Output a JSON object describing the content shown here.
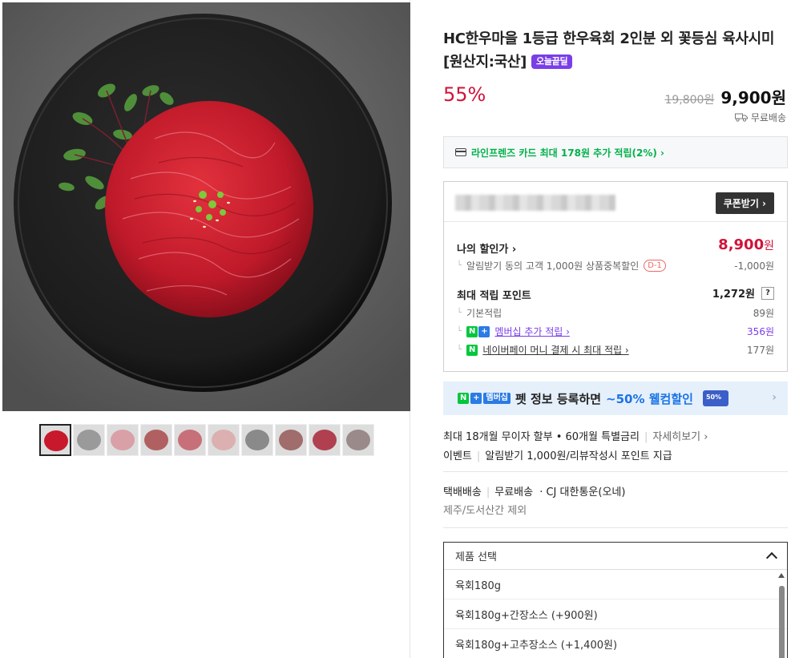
{
  "product": {
    "title": "HC한우마을 1등급 한우육회 2인분 외 꽃등심 육사시미 [원산지:국산]",
    "badge": "오늘끝딜",
    "discount_rate": "55%",
    "original_price": "19,800원",
    "sale_price": "9,900원",
    "delivery": "무료배송"
  },
  "thumbnails": {
    "count": 10,
    "colors": [
      "#c8182c",
      "#9a9a9a",
      "#d9a0a8",
      "#b06060",
      "#c8707a",
      "#dcb0b0",
      "#8a8a8a",
      "#a06c6c",
      "#b04050",
      "#9a8a8a"
    ]
  },
  "card_benefit": "라인프렌즈 카드 최대 178원 추가 적립(2%) ›",
  "benefit": {
    "coupon_button": "쿠폰받기 ›",
    "my_price_label": "나의 할인가 ›",
    "my_price": "8,900",
    "my_price_unit": "원",
    "notify_discount_label": "알림받기 동의 고객 1,000원 상품중복할인",
    "notify_discount_tag": "D-1",
    "notify_discount_value": "-1,000원",
    "max_point_label": "최대 적립 포인트",
    "max_point_value": "1,272원",
    "help_label": "?",
    "basic_label": "기본적립",
    "basic_value": "89원",
    "membership_badge_n": "N",
    "membership_badge_plus": "+",
    "membership_label": "멤버십 추가 적립 ›",
    "membership_value": "356원",
    "npay_badge": "N",
    "npay_label": "네이버페이 머니 결제 시 최대 적립 ›",
    "npay_value": "177원"
  },
  "banner": {
    "badge_n": "N",
    "badge_plus": "+",
    "badge_text": "멤버십",
    "text": "펫 정보 등록하면",
    "highlight": "~50% 웰컴할인"
  },
  "installment": {
    "text": "최대 18개월 무이자 할부 • 60개월 특별금리",
    "link": "자세히보기 ›"
  },
  "event": {
    "label": "이벤트",
    "text": "알림받기 1,000원/리뷰작성시 포인트 지급"
  },
  "shipping": {
    "type": "택배배송",
    "fee": "무료배송",
    "carrier": "· CJ 대한통운(오네)",
    "note": "제주/도서산간 제외"
  },
  "options": {
    "header": "제품 선택",
    "items": [
      "육회180g",
      "육회180g+간장소스 (+900원)",
      "육회180g+고추장소스 (+1,400원)"
    ]
  }
}
